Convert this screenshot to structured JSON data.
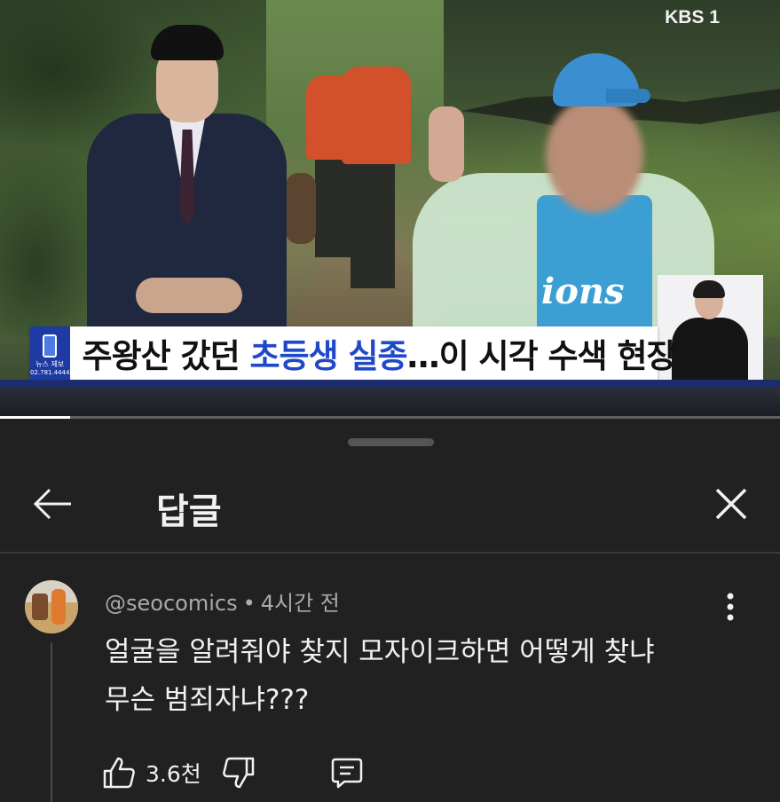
{
  "video": {
    "channel_logo": "KBS 1",
    "caption": {
      "badge_line1": "뉴스 제보",
      "badge_line2": "02.781.4444",
      "headline_part1": "주왕산 갔던 ",
      "headline_highlight": "초등생 실종",
      "headline_part2": "…이 시각 수색 현장"
    },
    "jersey_text": "ions",
    "progress": 0.09
  },
  "sheet": {
    "title": "답글",
    "back_icon": "arrow-left-icon",
    "close_icon": "close-icon"
  },
  "comment": {
    "author": "@seocomics",
    "separator": "•",
    "time": "4시간 전",
    "text_line1": "얼굴을 알려줘야 찾지 모자이크하면 어떻게 찾냐",
    "text_line2": "무슨 범죄자냐???",
    "like_count": "3.6천",
    "icons": [
      "thumbs-up-icon",
      "thumbs-down-icon",
      "reply-icon",
      "more-vertical-icon"
    ]
  },
  "colors": {
    "background": "#0f0f0f",
    "sheet": "#212121",
    "text_primary": "#f1f1f1",
    "text_secondary": "#aaaaaa",
    "caption_highlight": "#1f49c8",
    "caption_badge": "#1e3aa3"
  }
}
